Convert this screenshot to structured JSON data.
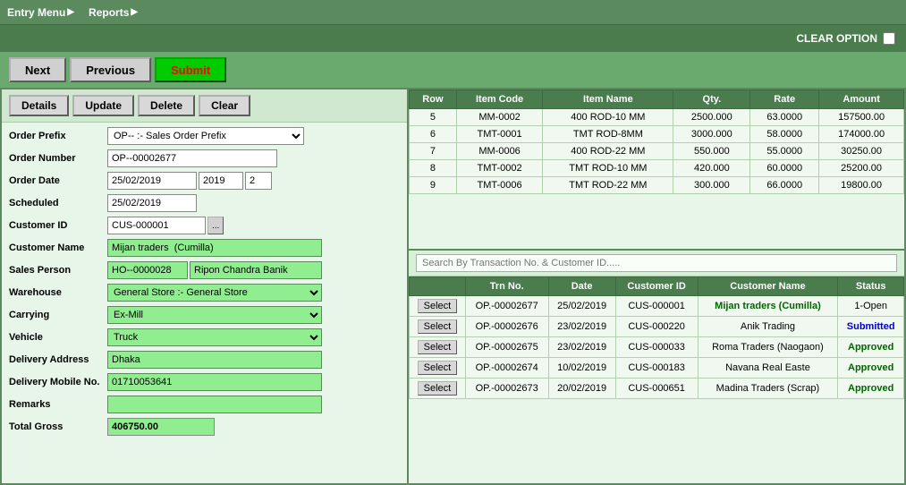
{
  "menu": {
    "items": [
      {
        "label": "Entry Menu",
        "arrow": "▶"
      },
      {
        "label": "Reports",
        "arrow": "▶"
      }
    ]
  },
  "clear_option": {
    "label": "CLEAR OPTION"
  },
  "nav": {
    "next_label": "Next",
    "previous_label": "Previous",
    "submit_label": "Submit"
  },
  "action_buttons": {
    "details": "Details",
    "update": "Update",
    "delete": "Delete",
    "clear": "Clear"
  },
  "form": {
    "order_prefix_label": "Order Prefix",
    "order_prefix_value": "OP-- :- Sales Order Prefix",
    "order_number_label": "Order Number",
    "order_number_value": "OP--00002677",
    "order_date_label": "Order Date",
    "order_date_value": "25/02/2019",
    "order_date_year": "2019",
    "order_date_num": "2",
    "scheduled_label": "Scheduled",
    "scheduled_value": "25/02/2019",
    "customer_id_label": "Customer ID",
    "customer_id_value": "CUS-000001",
    "customer_name_label": "Customer Name",
    "customer_name_value": "Mijan traders  (Cumilla)",
    "sales_person_label": "Sales Person",
    "sales_person_code": "HO--0000028",
    "sales_person_name": "Ripon Chandra Banik",
    "warehouse_label": "Warehouse",
    "warehouse_value": "General Store :- General Store",
    "carrying_label": "Carrying",
    "carrying_value": "Ex-Mill",
    "vehicle_label": "Vehicle",
    "vehicle_value": "Truck",
    "delivery_address_label": "Delivery Address",
    "delivery_address_value": "Dhaka",
    "delivery_mobile_label": "Delivery Mobile No.",
    "delivery_mobile_value": "01710053641",
    "remarks_label": "Remarks",
    "remarks_value": "",
    "total_gross_label": "Total Gross",
    "total_gross_value": "406750.00"
  },
  "items_table": {
    "headers": [
      "Row",
      "Item Code",
      "Item Name",
      "Qty.",
      "Rate",
      "Amount"
    ],
    "rows": [
      {
        "row": "5",
        "code": "MM-0002",
        "name": "400 ROD-10 MM",
        "qty": "2500.000",
        "rate": "63.0000",
        "amount": "157500.00"
      },
      {
        "row": "6",
        "code": "TMT-0001",
        "name": "TMT ROD-8MM",
        "qty": "3000.000",
        "rate": "58.0000",
        "amount": "174000.00"
      },
      {
        "row": "7",
        "code": "MM-0006",
        "name": "400 ROD-22 MM",
        "qty": "550.000",
        "rate": "55.0000",
        "amount": "30250.00"
      },
      {
        "row": "8",
        "code": "TMT-0002",
        "name": "TMT ROD-10 MM",
        "qty": "420.000",
        "rate": "60.0000",
        "amount": "25200.00"
      },
      {
        "row": "9",
        "code": "TMT-0006",
        "name": "TMT ROD-22 MM",
        "qty": "300.000",
        "rate": "66.0000",
        "amount": "19800.00"
      }
    ]
  },
  "search": {
    "placeholder": "Search By Transaction No. & Customer ID....."
  },
  "transactions_table": {
    "headers": [
      "",
      "Trn No.",
      "Date",
      "Customer ID",
      "Customer Name",
      "Status"
    ],
    "rows": [
      {
        "select": "Select",
        "trn": "OP.-00002677",
        "date": "25/02/2019",
        "cust_id": "CUS-000001",
        "cust_name": "Mijan traders (Cumilla)",
        "status": "1-Open",
        "status_class": "status-open",
        "name_class": "customer-name-green"
      },
      {
        "select": "Select",
        "trn": "OP.-00002676",
        "date": "23/02/2019",
        "cust_id": "CUS-000220",
        "cust_name": "Anik Trading",
        "status": "Submitted",
        "status_class": "status-submitted",
        "name_class": ""
      },
      {
        "select": "Select",
        "trn": "OP.-00002675",
        "date": "23/02/2019",
        "cust_id": "CUS-000033",
        "cust_name": "Roma Traders (Naogaon)",
        "status": "Approved",
        "status_class": "status-approved",
        "name_class": ""
      },
      {
        "select": "Select",
        "trn": "OP.-00002674",
        "date": "10/02/2019",
        "cust_id": "CUS-000183",
        "cust_name": "Navana Real Easte",
        "status": "Approved",
        "status_class": "status-approved",
        "name_class": ""
      },
      {
        "select": "Select",
        "trn": "OP.-00002673",
        "date": "20/02/2019",
        "cust_id": "CUS-000651",
        "cust_name": "Madina Traders (Scrap)",
        "status": "Approved",
        "status_class": "status-approved",
        "name_class": ""
      }
    ]
  }
}
